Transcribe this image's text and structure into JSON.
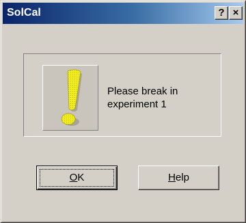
{
  "window": {
    "title": "SolCal",
    "help_button": "?",
    "close_button": "×"
  },
  "message": {
    "icon": "exclamation-icon",
    "line1": "Please break in",
    "line2": "experiment 1"
  },
  "buttons": {
    "ok": {
      "mnemonic": "O",
      "rest": "K"
    },
    "help": {
      "mnemonic": "H",
      "rest": "elp"
    }
  },
  "colors": {
    "title_bar_start": "#0a246a",
    "title_bar_end": "#a6caf0",
    "dialog_face": "#d4d0c8",
    "icon_yellow": "#f2ee1e"
  }
}
